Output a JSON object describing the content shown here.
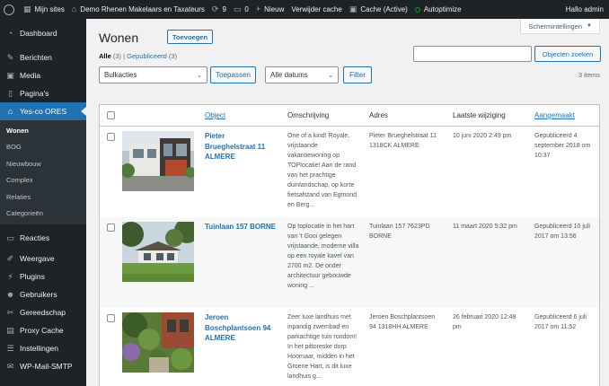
{
  "adminbar": {
    "site_name": "Mijn sites",
    "site_title": "Demo Rhenen Makelaars en Taxateurs",
    "updates_count": "9",
    "comments_count": "0",
    "new_label": "Nieuw",
    "clear_cache": "Verwijder cache",
    "cache_status": "Cache (Active)",
    "autoptimize": "Autoptimize",
    "greeting": "Hallo admin"
  },
  "sidebar": {
    "items": [
      {
        "label": "Dashboard",
        "icon": "dashboard-icon"
      },
      {
        "label": "Berichten",
        "icon": "pin-icon"
      },
      {
        "label": "Media",
        "icon": "media-icon"
      },
      {
        "label": "Pagina's",
        "icon": "page-icon"
      },
      {
        "label": "Yes-co ORES",
        "icon": "home-icon"
      },
      {
        "label": "Reacties",
        "icon": "comment-icon"
      },
      {
        "label": "Weergave",
        "icon": "brush-icon"
      },
      {
        "label": "Plugins",
        "icon": "plugin-icon"
      },
      {
        "label": "Gebruikers",
        "icon": "users-icon"
      },
      {
        "label": "Gereedschap",
        "icon": "wrench-icon"
      },
      {
        "label": "Proxy Cache",
        "icon": "cache-icon"
      },
      {
        "label": "Instellingen",
        "icon": "settings-icon"
      },
      {
        "label": "WP-Mail-SMTP",
        "icon": "mail-icon"
      }
    ],
    "submenu": [
      "Wonen",
      "BOG",
      "Nieuwbouw",
      "Complex",
      "Relaties",
      "Categorieën"
    ]
  },
  "screen_options": "Schermintellingen",
  "page": {
    "title": "Wonen",
    "add_new": "Toevoegen",
    "filter_all": "Alle",
    "filter_all_count": "(3)",
    "filter_published": "Gepubliceerd",
    "filter_published_count": "(3)",
    "search_button": "Objecten zoeken",
    "bulk_actions": "Bulkacties",
    "apply": "Toepassen",
    "all_dates": "Alle datums",
    "filter_button": "Filter",
    "items_count": "3 items"
  },
  "table": {
    "headers": {
      "object": "Object",
      "description": "Omschrijving",
      "address": "Adres",
      "modified": "Laatste wijziging",
      "created": "Aangemaakt"
    },
    "rows": [
      {
        "title": "Pieter Brueghelstraat 11 ALMERE",
        "description": "One of a kind! Royale, vrijstaande vakantiewoning op TOPlocatie! Aan de rand van het prachtige duinlandschap, op korte fietsafstand van Egmond en Berg...",
        "address": "Pieter Brueghelstraat 11 1318CK ALMERE",
        "modified": "10 juni 2020 2:49 pm",
        "created": "Gepubliceerd 4 september 2018 om 10:37"
      },
      {
        "title": "Tuinlaan 157 BORNE",
        "description": "Op toplocatie in het hart van 't Gooi gelegen vrijstaande, moderne villa op een royale kavel van 2700 m2. De onder architectuur gebouwde woning ...",
        "address": "Tuinlaan 157 7623PD BORNE",
        "modified": "11 maart 2020 5:32 pm",
        "created": "Gepubliceerd 10 juli 2017 om 13:56"
      },
      {
        "title": "Jeroen Boschplantsoen 94 ALMERE",
        "description": "Zeer luxe landhuis met inpandig zwembad en parkachtige tuin rondom! In het pittoreske dorp Hoornaar, midden in het Groene Hart, is dit luxe landhuis g...",
        "address": "Jeroen Boschplantsoen 94 1318HH ALMERE",
        "modified": "26 februari 2020 12:48 pm",
        "created": "Gepubliceerd 6 juli 2017 om 11:52"
      }
    ]
  }
}
